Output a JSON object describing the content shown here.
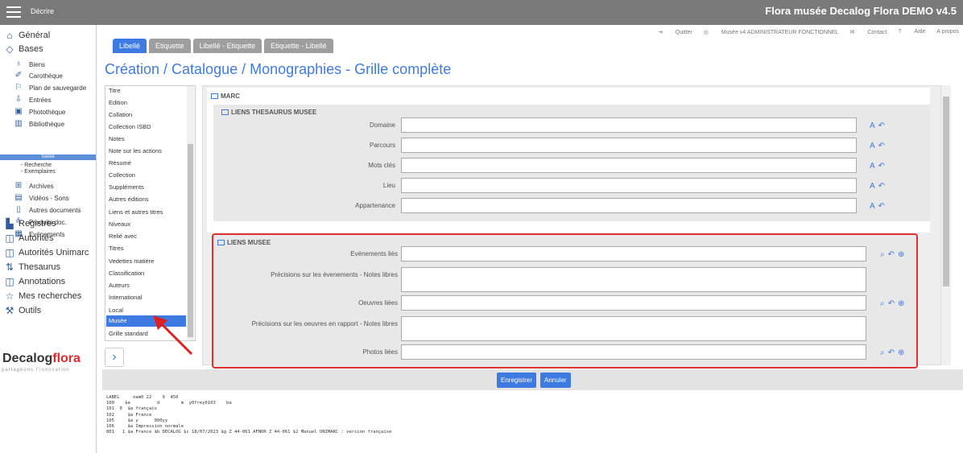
{
  "topbar": {
    "context": "Décrire",
    "app_title": "Flora musée Decalog Flora DEMO v4.5"
  },
  "sidebar": {
    "general": "Général",
    "bases": "Bases",
    "items": [
      "Biens",
      "Carothèque",
      "Plan de sauvegarde",
      "Entrées",
      "Photothèque",
      "Bibliothèque"
    ],
    "saisie": "Saisie",
    "recherche": "- Recherche",
    "exemplaires": "- Exemplaires",
    "items2": [
      "Archives",
      "Vidéos - Sons",
      "Autres documents",
      "Produits doc.",
      "Evénements"
    ],
    "top2": [
      "Registres",
      "Autorités",
      "Autorités Unimarc",
      "Thesaurus",
      "Annotations",
      "Mes recherches",
      "Outils"
    ],
    "logo_a": "Decalog",
    "logo_b": "flora",
    "tagline": "partageons l'innovation"
  },
  "tabs": [
    "Libellé",
    "Etiquette",
    "Libellé - Etiquette",
    "Etiquette - Libellé"
  ],
  "toplinks": [
    "Quitter",
    "Musée v4 ADMINISTRATEUR FONCTIONNEL",
    "Contact",
    "Aide",
    "A propos"
  ],
  "page_title": "Création / Catalogue / Monographies - Grille complète",
  "fields": [
    "Titre",
    "Edition",
    "Collation",
    "Collection ISBD",
    "Notes",
    "Note sur les actions",
    "Résumé",
    "Collection",
    "Suppléments",
    "Autres éditions",
    "Liens et autres titres",
    "Niveaux",
    "Relié avec",
    "Titres",
    "Vedettes matière",
    "Classification",
    "Auteurs",
    "International",
    "Local",
    "Musée",
    "Grille standard"
  ],
  "selected_field": "Musée",
  "form": {
    "marc": "MARC",
    "thes_title": "LIENS THESAURUS MUSEE",
    "thes_labels": [
      "Domaine",
      "Parcours",
      "Mots clés",
      "Lieu",
      "Appartenance"
    ],
    "musee_title": "LIENS MUSEE",
    "musee_labels": [
      "Evénements liés",
      "Précisions sur les évenements - Notes libres",
      "Oeuvres liées",
      "Précisions sur les oeuvres en rapport - Notes libres",
      "Photos liées"
    ]
  },
  "buttons": {
    "save": "Enregistrer",
    "cancel": "Annuler"
  },
  "marc_dump": "LABEL     nam0 22    9  450\n100    $a          d        m  y0frey0103    ba\n101  0  $a français\n102     $a France\n105     $a y      000yy\n106     $a Impression normale\n801   1 $a France $b DECALOG $c 18/07/2023 $g Z 44-061 AFNOR Z 44-061 $2 Manuel UNIMARC : version française"
}
